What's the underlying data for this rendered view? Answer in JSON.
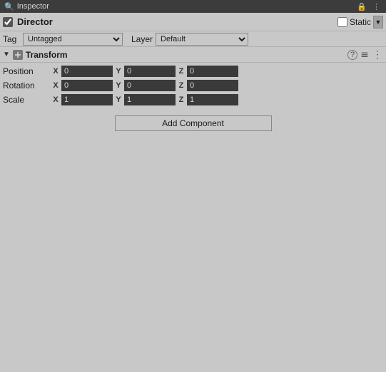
{
  "titlebar": {
    "label": "Inspector",
    "lock_icon": "🔒",
    "menu_icon": "⋮"
  },
  "gameobject": {
    "enabled": true,
    "name": "Director",
    "static_label": "Static",
    "static_enabled": false
  },
  "tag_layer": {
    "tag_label": "Tag",
    "tag_value": "Untagged",
    "layer_label": "Layer",
    "layer_value": "Default"
  },
  "transform": {
    "title": "Transform",
    "position_label": "Position",
    "rotation_label": "Rotation",
    "scale_label": "Scale",
    "x_label": "X",
    "y_label": "Y",
    "z_label": "Z",
    "position": {
      "x": "0",
      "y": "0",
      "z": "0"
    },
    "rotation": {
      "x": "0",
      "y": "0",
      "z": "0"
    },
    "scale": {
      "x": "1",
      "y": "1",
      "z": "1"
    },
    "help_icon": "?",
    "settings_icon": "⚙",
    "menu_icon": "⋮"
  },
  "add_component": {
    "label": "Add Component"
  }
}
